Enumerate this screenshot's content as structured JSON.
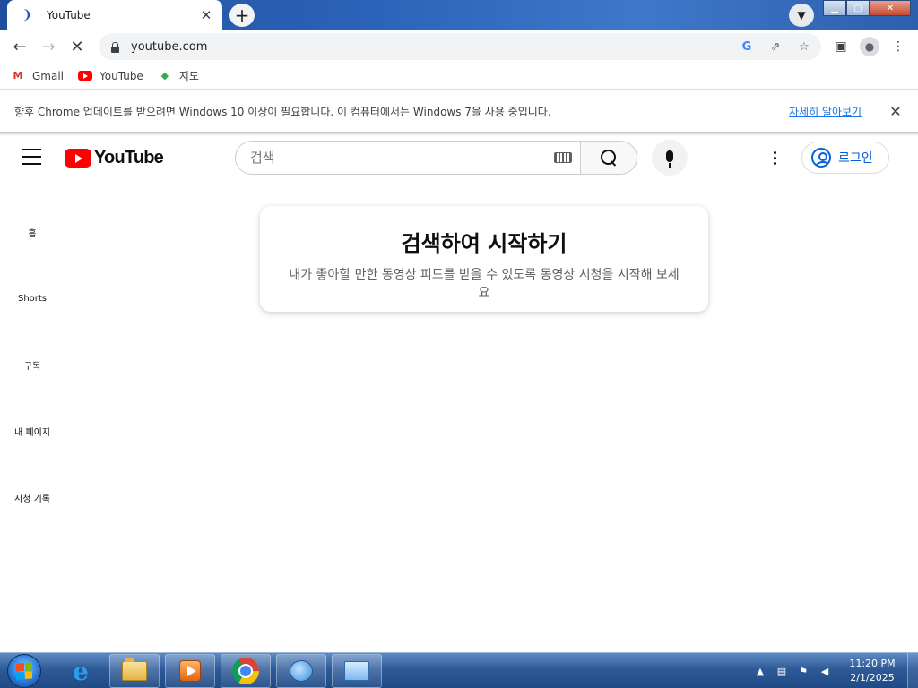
{
  "browser": {
    "tab": {
      "title": "YouTube"
    },
    "url": "youtube.com",
    "bookmarks": [
      {
        "label": "Gmail",
        "icon": "gmail-icon"
      },
      {
        "label": "YouTube",
        "icon": "youtube-icon"
      },
      {
        "label": "지도",
        "icon": "maps-icon"
      }
    ],
    "infobar": {
      "message": "향후 Chrome 업데이트를 받으려면 Windows 10 이상이 필요합니다. 이 컴퓨터에서는 Windows 7을 사용 중입니다.",
      "link": "자세히 알아보기"
    }
  },
  "youtube": {
    "logo_text": "YouTube",
    "search_placeholder": "검색",
    "signin_label": "로그인",
    "guide": [
      "홈",
      "Shorts",
      "구독",
      "내 페이지",
      "시청 기록"
    ],
    "promo": {
      "title": "검색하여 시작하기",
      "body": "내가 좋아할 만한 동영상 피드를 받을 수 있도록 동영상 시청을 시작해 보세요"
    }
  },
  "taskbar": {
    "time": "11:20 PM",
    "date": "2/1/2025"
  },
  "colors": {
    "youtube_red": "#ff0000",
    "link_blue": "#1a73e8",
    "signin_blue": "#065fd4",
    "taskbar_blue": "#2e5a97"
  }
}
